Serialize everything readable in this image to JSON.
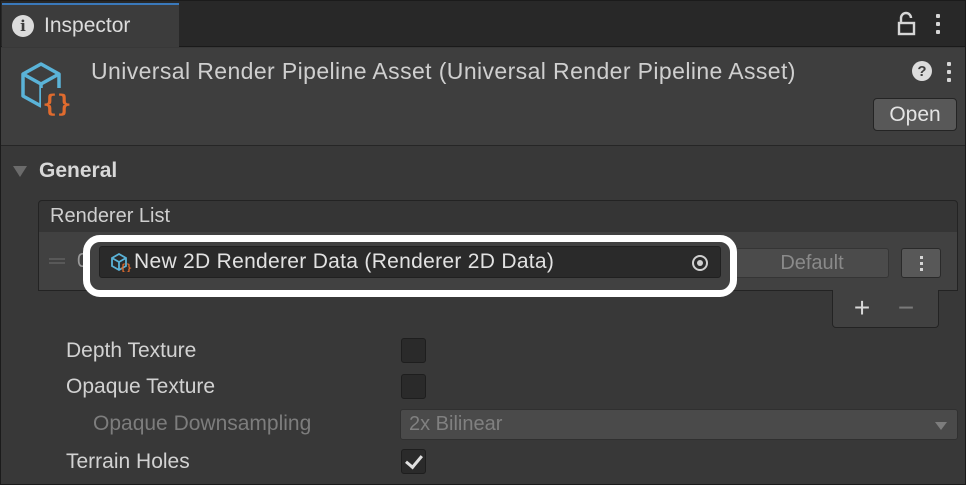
{
  "tab": {
    "title": "Inspector"
  },
  "asset": {
    "title": "Universal Render Pipeline Asset (Universal Render Pipeline Asset)",
    "open_label": "Open"
  },
  "general": {
    "label": "General"
  },
  "renderer_list": {
    "header": "Renderer List",
    "items": [
      {
        "index": "0",
        "value": "New 2D Renderer Data (Renderer 2D Data)",
        "default_label": "Default"
      }
    ]
  },
  "properties": {
    "depth_texture": {
      "label": "Depth Texture",
      "checked": false
    },
    "opaque_texture": {
      "label": "Opaque Texture",
      "checked": false
    },
    "opaque_downsampling": {
      "label": "Opaque Downsampling",
      "value": "2x Bilinear"
    },
    "terrain_holes": {
      "label": "Terrain Holes",
      "checked": true
    }
  },
  "colors": {
    "background": "#383838",
    "tab_accent": "#3a79bb",
    "highlight": "#ffffff",
    "icon_accent": "#e06b2e",
    "icon_blue": "#5ab3d8"
  }
}
